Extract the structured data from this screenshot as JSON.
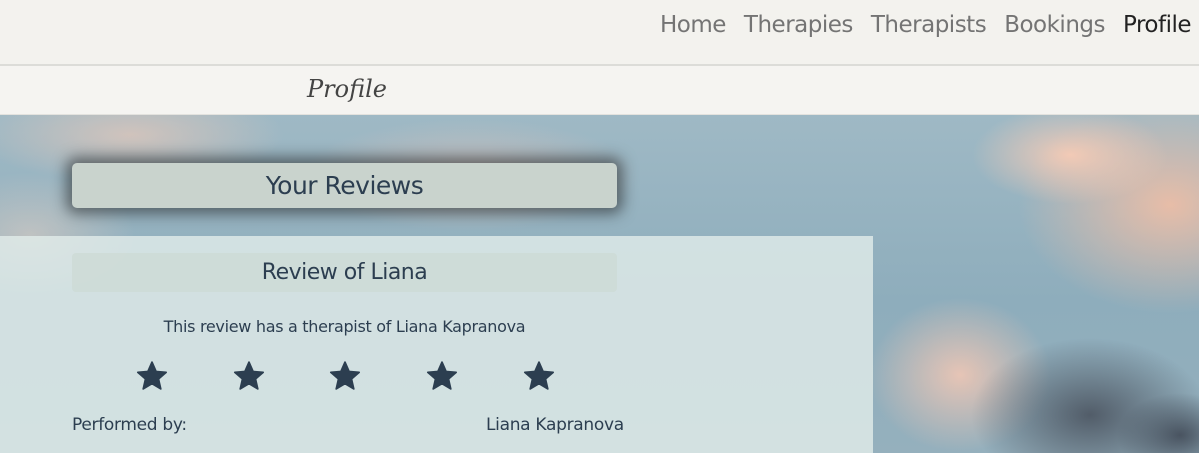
{
  "nav": {
    "items": [
      {
        "label": "Home"
      },
      {
        "label": "Therapies"
      },
      {
        "label": "Therapists"
      },
      {
        "label": "Bookings"
      },
      {
        "label": "Profile"
      }
    ],
    "active": "Profile"
  },
  "page": {
    "heading": "Profile"
  },
  "reviews_section": {
    "title": "Your Reviews",
    "review": {
      "title": "Review of Liana",
      "description": "This review has a therapist of Liana Kapranova",
      "rating": 5,
      "rating_max": 5,
      "performed_by_label": "Performed by:",
      "performed_by_value": "Liana Kapranova"
    }
  },
  "colors": {
    "text_dark": "#2c3e50",
    "nav_inactive": "#747474",
    "nav_active": "#222222",
    "star": "#2c3e50"
  },
  "icons": {
    "rating": "star-icon"
  }
}
